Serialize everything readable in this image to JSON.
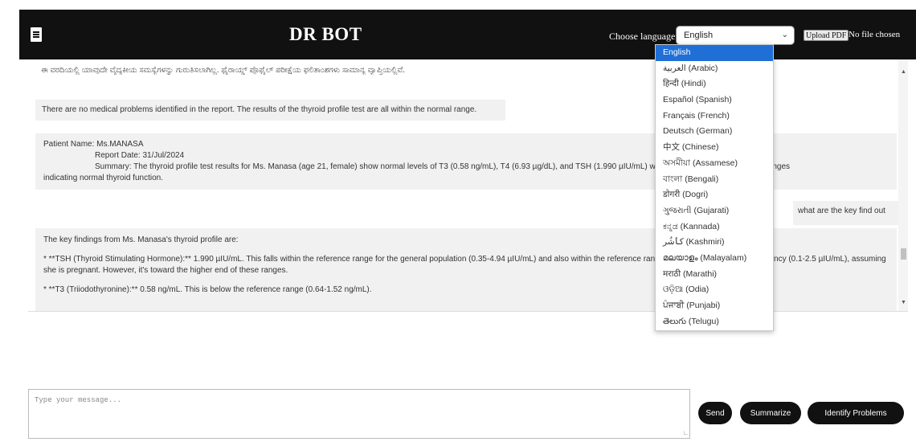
{
  "header": {
    "title": "DR BOT",
    "language_label": "Choose language:",
    "selected_language": "English",
    "upload_button": "Upload PDF",
    "file_status": "No file chosen"
  },
  "language_options": [
    "English",
    "العربية (Arabic)",
    "हिन्दी (Hindi)",
    "Español (Spanish)",
    "Français (French)",
    "Deutsch (German)",
    "中文 (Chinese)",
    "অসমীয়া (Assamese)",
    "বাংলা (Bengali)",
    "डोगरी (Dogri)",
    "ગુજરાતી (Gujarati)",
    "ಕನ್ನಡ (Kannada)",
    "کٲشُر (Kashmiri)",
    "മലയാളം (Malayalam)",
    "मराठी (Marathi)",
    "ଓଡ଼ିଆ (Odia)",
    "ਪੰਜਾਬੀ (Punjabi)",
    "తెలుగు (Telugu)"
  ],
  "chat": {
    "partial_message": "ಈ ವರದಿಯಲ್ಲಿ ಯಾವುದೇ ವೈದ್ಯಕೀಯ ಸಮಸ್ಯೆಗಳನ್ನು ಗುರುತಿಸಲಾಗಿಲ್ಲ. ಥೈರಾಯ್ಡ್ ಪ್ರೊಫೈಲ್ ಪರೀಕ್ಷೆಯ ಫಲಿತಾಂಶಗಳು ಸಾಮಾನ್ಯ ವ್ಯಾಪ್ತಿಯಲ್ಲಿವೆ.",
    "message_1": "There are no medical problems identified in the report. The results of the thyroid profile test are all within the normal range.",
    "message_2": {
      "patient": "Patient Name: Ms.MANASA",
      "report_date": "Report Date: 31/Jul/2024",
      "summary_a": "Summary: The thyroid profile test results for Ms. Manasa (age 21, female) show normal levels of T3 (0.58 ng/mL), T4 (6.93 µg/dL), and TSH (1.990 µIU/mL) within their respective reference ranges",
      "summary_b": "indicating normal thyroid function."
    },
    "user_message": "what are the key find out",
    "message_3": {
      "intro": "The key findings from Ms. Manasa's thyroid profile are:",
      "tsh": "* **TSH (Thyroid Stimulating Hormone):** 1.990 µIU/mL.  This falls within the reference range for the general population (0.35-4.94 µIU/mL) and also within the reference range for the first trimester of pregnancy (0.1-2.5 µIU/mL), assuming she is pregnant.  However, it's toward the higher end of these ranges.",
      "t3": "* **T3 (Triiodothyronine):** 0.58 ng/mL.  This is below the reference range (0.64-1.52 ng/mL)."
    }
  },
  "composer": {
    "placeholder": "Type your message...",
    "send": "Send",
    "summarize": "Summarize",
    "identify": "Identify Problems"
  }
}
